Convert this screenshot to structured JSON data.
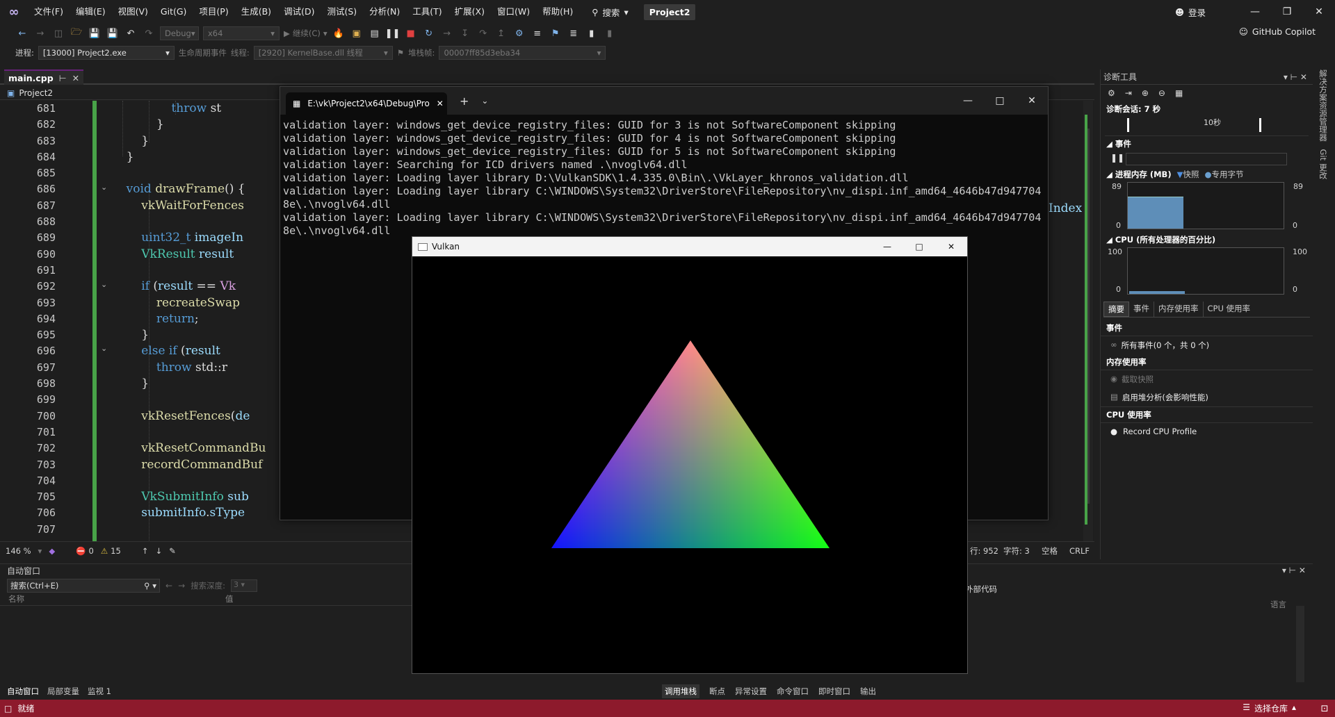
{
  "menubar": {
    "items": [
      "文件(F)",
      "编辑(E)",
      "视图(V)",
      "Git(G)",
      "项目(P)",
      "生成(B)",
      "调试(D)",
      "测试(S)",
      "分析(N)",
      "工具(T)",
      "扩展(X)",
      "窗口(W)",
      "帮助(H)"
    ],
    "search": "搜索",
    "project": "Project2",
    "login": "登录"
  },
  "toolbar": {
    "config": "Debug",
    "platform": "x64",
    "continue": "继续(C)",
    "copilot": "GitHub Copilot"
  },
  "debugbar": {
    "process_label": "进程:",
    "process": "[13000] Project2.exe",
    "lifecycle": "生命周期事件",
    "thread_label": "线程:",
    "thread": "[2920] KernelBase.dll 线程",
    "stack_label": "堆栈帧:",
    "stack": "00007ff85d3eba34"
  },
  "editor": {
    "tab": "main.cpp",
    "project": "Project2",
    "line_numbers": [
      "681",
      "682",
      "683",
      "684",
      "685",
      "686",
      "687",
      "688",
      "689",
      "690",
      "691",
      "692",
      "693",
      "694",
      "695",
      "696",
      "697",
      "698",
      "699",
      "700",
      "701",
      "702",
      "703",
      "704",
      "705",
      "706",
      "707"
    ],
    "right_fragment": "Index",
    "zoom": "146 %",
    "errors": "0",
    "warnings": "15",
    "line": "行: 952",
    "col": "字符: 3",
    "spaces": "空格",
    "eol": "CRLF"
  },
  "console": {
    "title": "E:\\vk\\Project2\\x64\\Debug\\Pro",
    "lines": [
      "validation layer: windows_get_device_registry_files: GUID for 3 is not SoftwareComponent skipping",
      "validation layer: windows_get_device_registry_files: GUID for 4 is not SoftwareComponent skipping",
      "validation layer: windows_get_device_registry_files: GUID for 5 is not SoftwareComponent skipping",
      "validation layer: Searching for ICD drivers named .\\nvoglv64.dll",
      "validation layer: Loading layer library D:\\VulkanSDK\\1.4.335.0\\Bin\\.\\VkLayer_khronos_validation.dll",
      "validation layer: Loading layer library C:\\WINDOWS\\System32\\DriverStore\\FileRepository\\nv_dispi.inf_amd64_4646b47d947704",
      "8e\\.\\nvoglv64.dll",
      "validation layer: Loading layer library C:\\WINDOWS\\System32\\DriverStore\\FileRepository\\nv_dispi.inf_amd64_4646b47d947704",
      "8e\\.\\nvoglv64.dll"
    ]
  },
  "vulkan": {
    "title": "Vulkan"
  },
  "diag": {
    "title": "诊断工具",
    "session": "诊断会话: 7 秒",
    "timeline_tick": "10秒",
    "events": "事件",
    "memory": "进程内存 (MB)",
    "snapshot": "快照",
    "private_bytes": "专用字节",
    "mem_max": "89",
    "mem_min": "0",
    "mem_level": 0.7,
    "cpu": "CPU (所有处理器的百分比)",
    "cpu_max": "100",
    "cpu_min": "0",
    "tabs": [
      "摘要",
      "事件",
      "内存使用率",
      "CPU 使用率"
    ],
    "sec_events": "事件",
    "all_events": "所有事件(0 个，共 0 个)",
    "sec_memory": "内存使用率",
    "take_snapshot": "截取快照",
    "heap": "启用堆分析(会影响性能)",
    "sec_cpu": "CPU 使用率",
    "record": "Record CPU Profile"
  },
  "autowin": {
    "title": "自动窗口",
    "search": "搜索(Ctrl+E)",
    "depth_label": "搜索深度:",
    "depth": "3",
    "col_name": "名称",
    "col_value": "值",
    "tabs": [
      "自动窗口",
      "局部变量",
      "监视 1"
    ]
  },
  "callwin": {
    "external": "外部代码",
    "lang": "语言",
    "tabs": [
      "调用堆栈",
      "断点",
      "异常设置",
      "命令窗口",
      "即时窗口",
      "输出"
    ]
  },
  "status": {
    "ready": "就绪",
    "repo": "选择仓库"
  },
  "colors": {
    "status_bar": "#8d1a2c",
    "accent": "#68217a",
    "change_bar": "#48a348"
  }
}
